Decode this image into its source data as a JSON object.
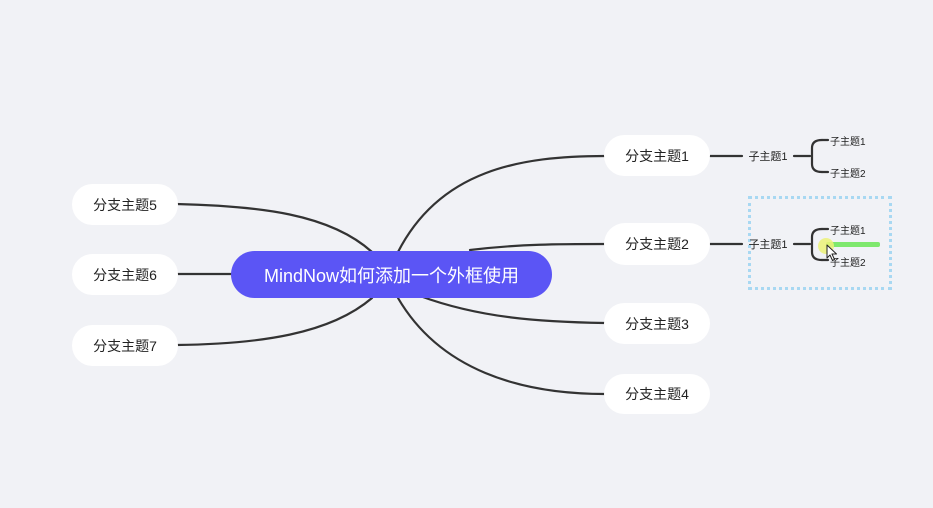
{
  "mindmap": {
    "root": {
      "label": "MindNow如何添加一个外框使用"
    },
    "branches": [
      {
        "id": "b1",
        "label": "分支主题1"
      },
      {
        "id": "b2",
        "label": "分支主题2"
      },
      {
        "id": "b3",
        "label": "分支主题3"
      },
      {
        "id": "b4",
        "label": "分支主题4"
      },
      {
        "id": "b5",
        "label": "分支主题5"
      },
      {
        "id": "b6",
        "label": "分支主题6"
      },
      {
        "id": "b7",
        "label": "分支主题7"
      }
    ],
    "subtopics": [
      {
        "parent": "b1",
        "label": "子主题1",
        "children": [
          "子主题1",
          "子主题2"
        ]
      },
      {
        "parent": "b2",
        "label": "子主题1",
        "children": [
          "子主题1",
          "子主题2"
        ]
      }
    ]
  },
  "colors": {
    "background": "#f1f2f6",
    "root_fill": "#5b55f5",
    "branch_fill": "#ffffff",
    "line": "#333333",
    "frame_border": "#a8d8f2",
    "drag_indicator": "#7ee86d"
  },
  "icons": {
    "cursor": "mouse-pointer-icon"
  }
}
